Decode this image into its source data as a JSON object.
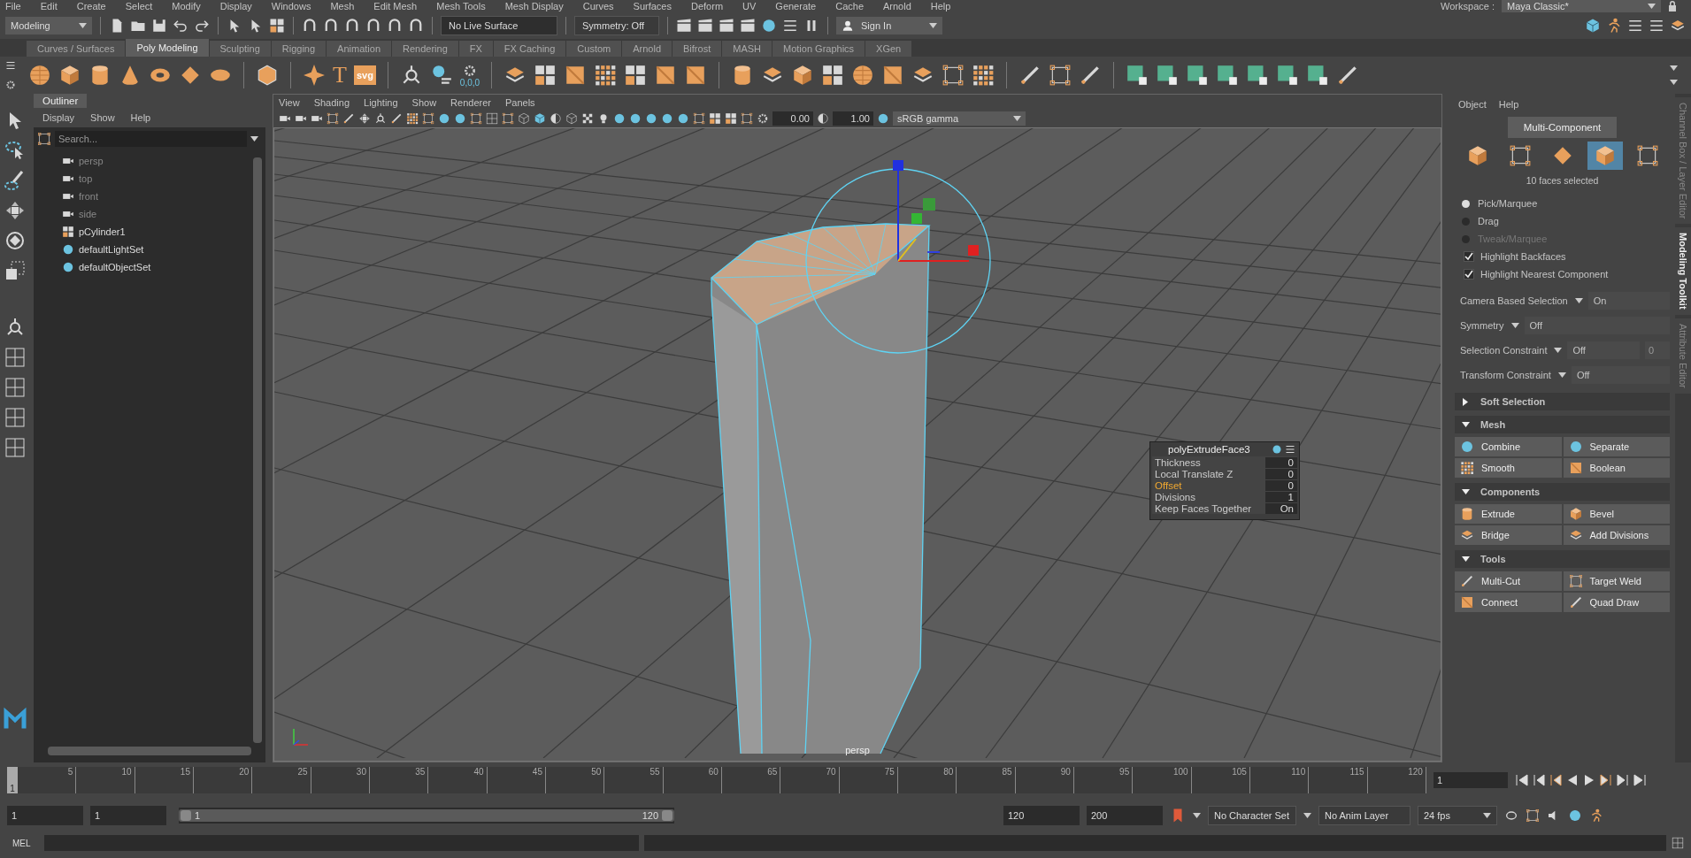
{
  "menu_bar": {
    "items": [
      "File",
      "Edit",
      "Create",
      "Select",
      "Modify",
      "Display",
      "Windows",
      "Mesh",
      "Edit Mesh",
      "Mesh Tools",
      "Mesh Display",
      "Curves",
      "Surfaces",
      "Deform",
      "UV",
      "Generate",
      "Cache",
      "Arnold",
      "Help"
    ],
    "workspace_label": "Workspace :",
    "workspace": "Maya Classic*"
  },
  "status_line": {
    "mode_menu": "Modeling",
    "live_surface": "No Live Surface",
    "symmetry": "Symmetry: Off",
    "sign_in": "Sign In"
  },
  "shelf": {
    "tabs": [
      {
        "label": "Curves / Surfaces",
        "selected": false
      },
      {
        "label": "Poly Modeling",
        "selected": true
      },
      {
        "label": "Sculpting",
        "selected": false
      },
      {
        "label": "Rigging",
        "selected": false
      },
      {
        "label": "Animation",
        "selected": false
      },
      {
        "label": "Rendering",
        "selected": false
      },
      {
        "label": "FX",
        "selected": false
      },
      {
        "label": "FX Caching",
        "selected": false
      },
      {
        "label": "Custom",
        "selected": false
      },
      {
        "label": "Arnold",
        "selected": false
      },
      {
        "label": "Bifrost",
        "selected": false
      },
      {
        "label": "MASH",
        "selected": false
      },
      {
        "label": "Motion Graphics",
        "selected": false
      },
      {
        "label": "XGen",
        "selected": false
      }
    ],
    "type_tool": "T",
    "svg_tool": "svg",
    "freeze_label": "0,0,0"
  },
  "outliner": {
    "title": "Outliner",
    "menu": [
      "Display",
      "Show",
      "Help"
    ],
    "search": {
      "placeholder": "Search..."
    },
    "items": [
      {
        "label": "persp",
        "kind": "camera",
        "dimmed": true
      },
      {
        "label": "top",
        "kind": "camera",
        "dimmed": true
      },
      {
        "label": "front",
        "kind": "camera",
        "dimmed": true
      },
      {
        "label": "side",
        "kind": "camera",
        "dimmed": true
      },
      {
        "label": "pCylinder1",
        "kind": "mesh",
        "dimmed": false
      },
      {
        "label": "defaultLightSet",
        "kind": "set",
        "dimmed": false
      },
      {
        "label": "defaultObjectSet",
        "kind": "set",
        "dimmed": false
      }
    ]
  },
  "viewport": {
    "menu": [
      "View",
      "Shading",
      "Lighting",
      "Show",
      "Renderer",
      "Panels"
    ],
    "exposure": "0.00",
    "gamma": "1.00",
    "color_space": "sRGB gamma",
    "camera_label": "persp",
    "node_editor": {
      "title": "polyExtrudeFace3",
      "rows": [
        {
          "label": "Thickness",
          "value": "0",
          "highlighted": false
        },
        {
          "label": "Local Translate Z",
          "value": "0",
          "highlighted": false
        },
        {
          "label": "Offset",
          "value": "0",
          "highlighted": true
        },
        {
          "label": "Divisions",
          "value": "1",
          "highlighted": false
        },
        {
          "label": "Keep Faces Together",
          "value": "On",
          "highlighted": false
        }
      ]
    }
  },
  "modeling_toolkit": {
    "menu": [
      "Object",
      "Help"
    ],
    "mode_button": "Multi-Component",
    "component_modes": [
      {
        "kind": "object",
        "selected": false
      },
      {
        "kind": "vertex",
        "selected": false
      },
      {
        "kind": "edge",
        "selected": false
      },
      {
        "kind": "face",
        "selected": true
      },
      {
        "kind": "uv",
        "selected": false
      }
    ],
    "selection_count": "10 faces selected",
    "pick_modes": [
      {
        "label": "Pick/Marquee",
        "selected": true,
        "disabled": false
      },
      {
        "label": "Drag",
        "selected": false,
        "disabled": false
      },
      {
        "label": "Tweak/Marquee",
        "selected": false,
        "disabled": true
      }
    ],
    "options": [
      {
        "label": "Highlight Backfaces",
        "checked": true
      },
      {
        "label": "Highlight Nearest Component",
        "checked": true
      }
    ],
    "settings": [
      {
        "label": "Camera Based Selection",
        "value": "On"
      },
      {
        "label": "Symmetry",
        "value": "Off"
      },
      {
        "label": "Selection Constraint",
        "value": "Off",
        "extra": "0"
      },
      {
        "label": "Transform Constraint",
        "value": "Off"
      }
    ],
    "sections": [
      {
        "title": "Soft Selection",
        "expanded": false
      },
      {
        "title": "Mesh",
        "expanded": true,
        "tools": [
          "Combine",
          "Separate",
          "Smooth",
          "Boolean"
        ]
      },
      {
        "title": "Components",
        "expanded": true,
        "tools": [
          "Extrude",
          "Bevel",
          "Bridge",
          "Add Divisions"
        ]
      },
      {
        "title": "Tools",
        "expanded": true,
        "tools": [
          "Multi-Cut",
          "Target Weld",
          "Connect",
          "Quad Draw"
        ]
      }
    ]
  },
  "side_tabs": [
    {
      "label": "Channel Box / Layer Editor",
      "selected": false
    },
    {
      "label": "Modeling Toolkit",
      "selected": true
    },
    {
      "label": "Attribute Editor",
      "selected": false
    }
  ],
  "time_slider": {
    "current_frame": "1",
    "level": 0,
    "ticks": [
      "5",
      "10",
      "15",
      "20",
      "25",
      "30",
      "35",
      "40",
      "45",
      "50",
      "55",
      "60",
      "65",
      "70",
      "75",
      "80",
      "85",
      "90",
      "95",
      "100",
      "105",
      "110",
      "115",
      "120"
    ],
    "frame_field": "1"
  },
  "range_slider": {
    "level": 1,
    "start": "1",
    "playback_start": "1",
    "range_start": "1",
    "range_end": "120",
    "playback_end": "120",
    "end": "200",
    "character_set": "No Character Set",
    "anim_layer": "No Anim Layer",
    "fps": "24 fps"
  },
  "command_line": {
    "language": "MEL"
  }
}
